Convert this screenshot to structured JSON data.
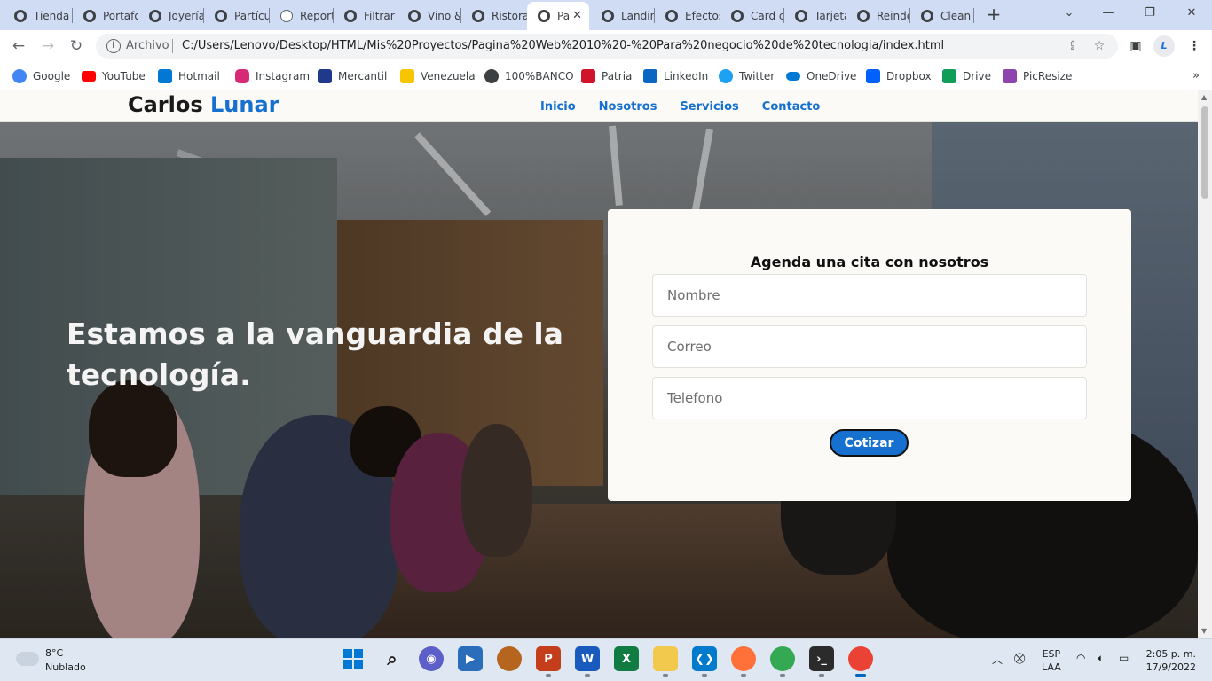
{
  "tabs": [
    {
      "title": "Tienda",
      "icon": "web-icon"
    },
    {
      "title": "Portafolio",
      "icon": "web-icon"
    },
    {
      "title": "Joyería",
      "icon": "web-icon"
    },
    {
      "title": "Partículas",
      "icon": "web-icon"
    },
    {
      "title": "Reporte",
      "icon": "globe-icon"
    },
    {
      "title": "Filtrar",
      "icon": "web-icon"
    },
    {
      "title": "Vino &",
      "icon": "web-icon"
    },
    {
      "title": "Ristorante",
      "icon": "web-icon"
    },
    {
      "title": "Pa",
      "icon": "web-icon",
      "active": true
    },
    {
      "title": "Landing",
      "icon": "web-icon"
    },
    {
      "title": "Efectos",
      "icon": "web-icon"
    },
    {
      "title": "Card c",
      "icon": "web-icon"
    },
    {
      "title": "Tarjeta",
      "icon": "web-icon"
    },
    {
      "title": "Reindeer",
      "icon": "web-icon"
    },
    {
      "title": "Clean",
      "icon": "web-icon"
    }
  ],
  "toolbar": {
    "scheme_label": "Archivo",
    "url": "C:/Users/Lenovo/Desktop/HTML/Mis%20Proyectos/Pagina%20Web%2010%20-%20Para%20negocio%20de%20tecnologia/index.html",
    "profile_initial": "L"
  },
  "bookmarks": [
    {
      "label": "Google",
      "color": "#4285f4"
    },
    {
      "label": "YouTube",
      "color": "#ff0000"
    },
    {
      "label": "Hotmail",
      "color": "#0078d4"
    },
    {
      "label": "Instagram",
      "color": "#d62976"
    },
    {
      "label": "Mercantil",
      "color": "#1f3a8a"
    },
    {
      "label": "Venezuela",
      "color": "#f7c600"
    },
    {
      "label": "100%BANCO",
      "color": "#3c4043"
    },
    {
      "label": "Patria",
      "color": "#cf142b"
    },
    {
      "label": "LinkedIn",
      "color": "#0a66c2"
    },
    {
      "label": "Twitter",
      "color": "#1da1f2"
    },
    {
      "label": "OneDrive",
      "color": "#0078d4"
    },
    {
      "label": "Dropbox",
      "color": "#0061ff"
    },
    {
      "label": "Drive",
      "color": "#0f9d58"
    },
    {
      "label": "PicResize",
      "color": "#8e44ad"
    }
  ],
  "site": {
    "logo_first": "Carlos ",
    "logo_second": "Lunar",
    "nav": [
      "Inicio",
      "Nosotros",
      "Servicios",
      "Contacto"
    ],
    "hero_title": "Estamos a la vanguardia de la tecnología.",
    "form": {
      "title": "Agenda una cita con nosotros",
      "name_placeholder": "Nombre",
      "email_placeholder": "Correo",
      "phone_placeholder": "Telefono",
      "submit_label": "Cotizar"
    },
    "brand_color": "#1670d0"
  },
  "taskbar": {
    "weather_temp": "8°C",
    "weather_desc": "Nublado",
    "language_line1": "ESP",
    "language_line2": "LAA",
    "time": "2:05 p. m.",
    "date": "17/9/2022",
    "apps": [
      {
        "name": "windows-start-icon",
        "color": "#0078d4"
      },
      {
        "name": "search-icon",
        "color": "#1b1b1b"
      },
      {
        "name": "chat-icon",
        "color": "#5b5fc7"
      },
      {
        "name": "media-player-icon",
        "color": "#2a6ebb"
      },
      {
        "name": "baseball-glove-icon",
        "color": "#b5651d"
      },
      {
        "name": "powerpoint-icon",
        "color": "#c43e1c"
      },
      {
        "name": "word-icon",
        "color": "#185abd"
      },
      {
        "name": "excel-icon",
        "color": "#107c41"
      },
      {
        "name": "file-explorer-icon",
        "color": "#f2c94c"
      },
      {
        "name": "vscode-icon",
        "color": "#007acc"
      },
      {
        "name": "firefox-icon",
        "color": "#ff7139"
      },
      {
        "name": "chrome-icon",
        "color": "#34a853"
      },
      {
        "name": "terminal-icon",
        "color": "#2b2b2b"
      },
      {
        "name": "chrome-profile-icon",
        "color": "#ea4335"
      }
    ]
  }
}
